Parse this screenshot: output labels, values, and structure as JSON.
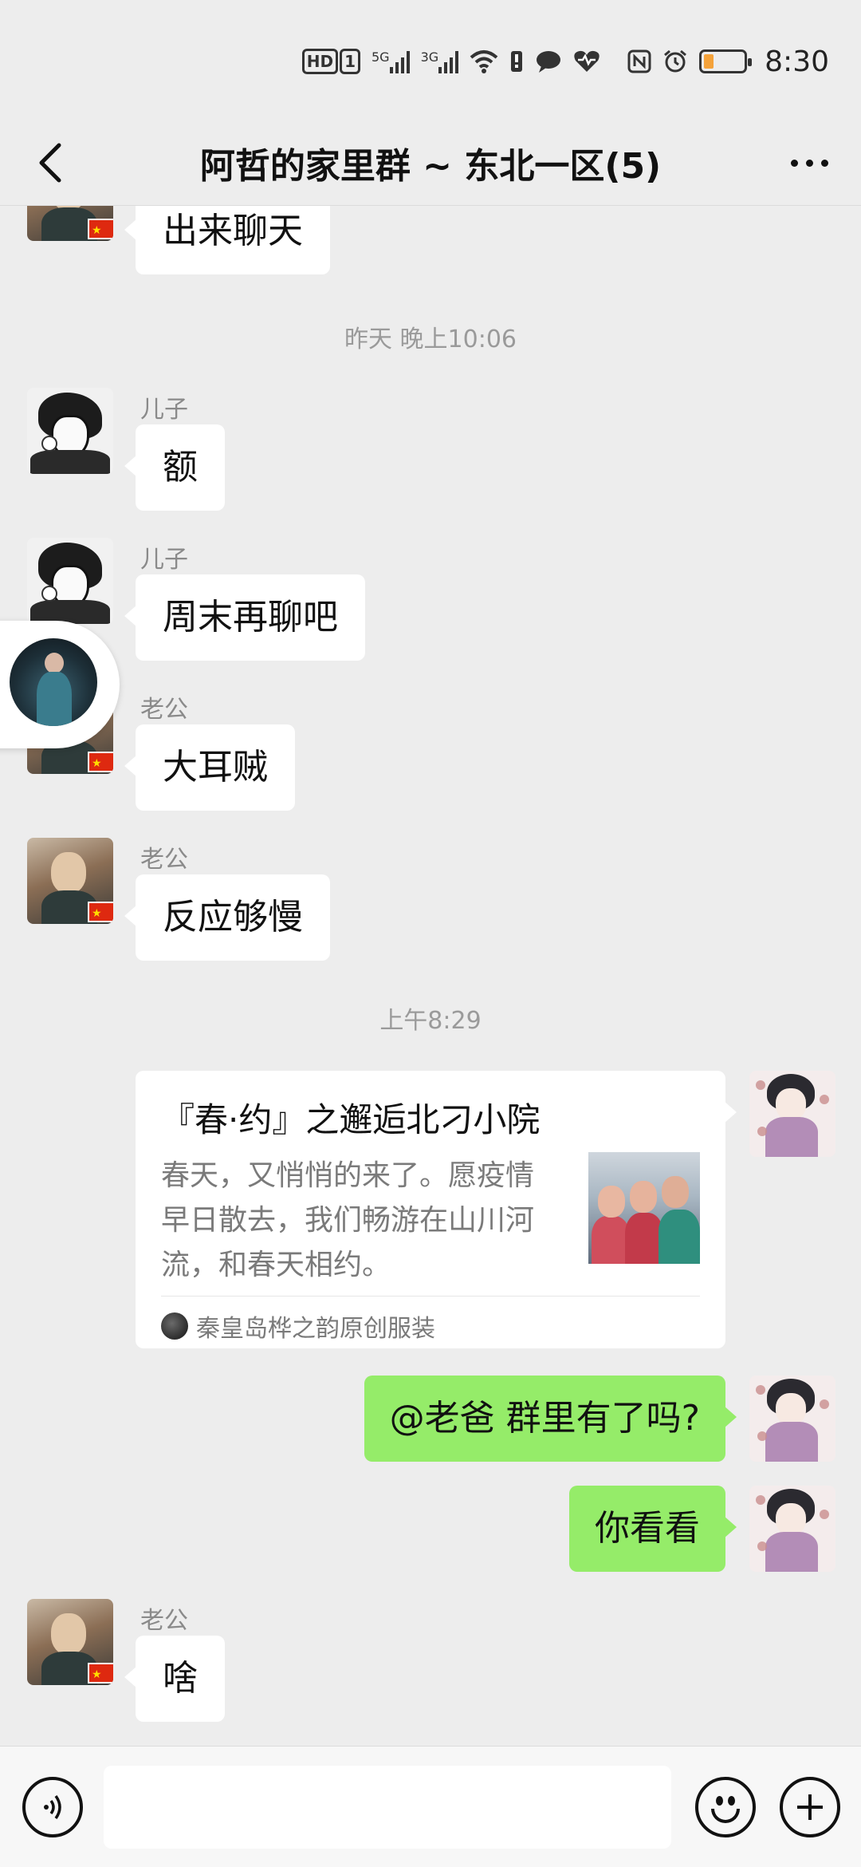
{
  "status_bar": {
    "time": "8:30",
    "hd_label": "HD",
    "sim_label": "1",
    "net1": "5G",
    "net2": "3G",
    "icons": [
      "hd-icon",
      "signal-5g-icon",
      "signal-3g-icon",
      "wifi-icon",
      "sim-icon",
      "message-icon",
      "health-icon",
      "nfc-icon",
      "alarm-icon",
      "battery-icon"
    ],
    "battery_color": "#f4a23a"
  },
  "header": {
    "title": "阿哲的家里群 ~ 东北一区(5)",
    "back_icon": "chevron-left-icon",
    "more_icon": "more-dots-icon"
  },
  "messages": [
    {
      "type": "in",
      "sender": "",
      "avatar": "husband",
      "text": "出来聊天"
    },
    {
      "type": "time",
      "text": "昨天 晚上10:06"
    },
    {
      "type": "in",
      "sender": "儿子",
      "avatar": "son",
      "text": "额"
    },
    {
      "type": "in",
      "sender": "儿子",
      "avatar": "son",
      "text": "周末再聊吧"
    },
    {
      "type": "in",
      "sender": "老公",
      "avatar": "husband",
      "text": "大耳贼"
    },
    {
      "type": "in",
      "sender": "老公",
      "avatar": "husband",
      "text": "反应够慢"
    },
    {
      "type": "time",
      "text": "上午8:29"
    },
    {
      "type": "card_out",
      "avatar": "me",
      "title": "『春·约』之邂逅北刁小院",
      "description": "春天，又悄悄的来了。愿疫情早日散去，我们畅游在山川河流，和春天相约。",
      "source": "秦皇岛桦之韵原创服装"
    },
    {
      "type": "out",
      "avatar": "me",
      "text": "@老爸  群里有了吗?"
    },
    {
      "type": "out",
      "avatar": "me",
      "text": "你看看"
    },
    {
      "type": "in",
      "sender": "老公",
      "avatar": "husband",
      "text": "啥"
    }
  ],
  "input_bar": {
    "voice_icon": "voice-icon",
    "placeholder": "",
    "emoji_icon": "emoji-icon",
    "plus_icon": "plus-icon"
  },
  "colors": {
    "background": "#ededed",
    "outgoing_bubble": "#95ec69",
    "incoming_bubble": "#ffffff"
  }
}
